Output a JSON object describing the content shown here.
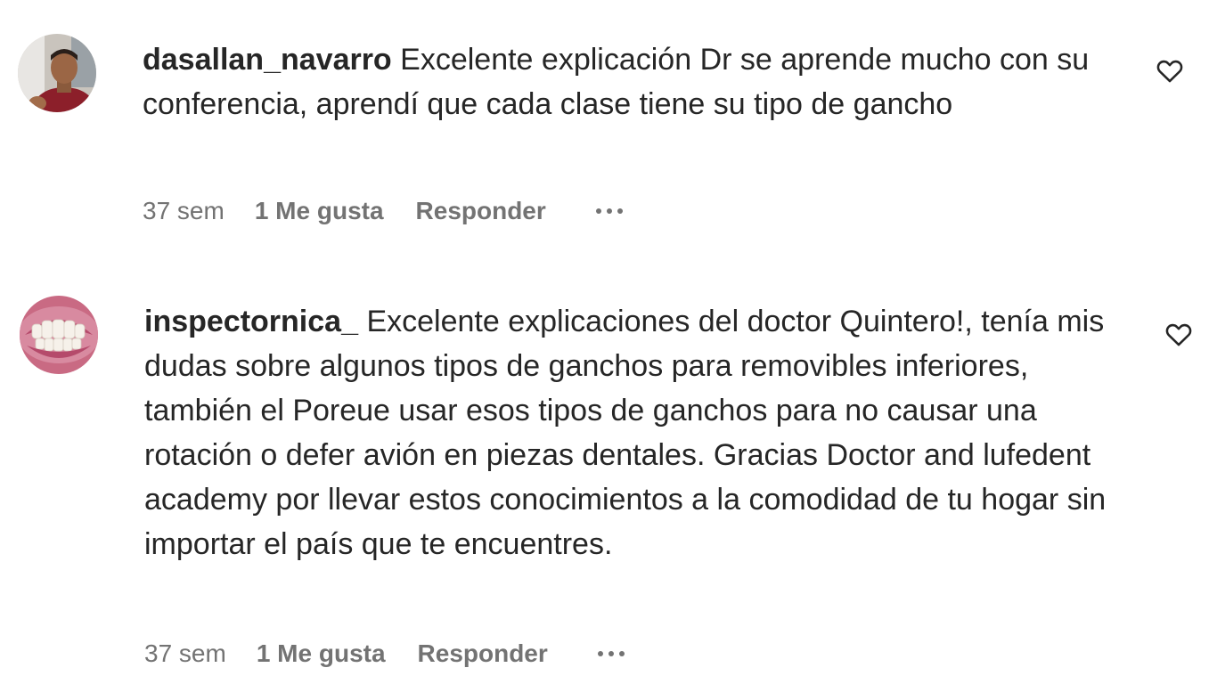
{
  "comments": [
    {
      "username": "dasallan_navarro",
      "text": "Excelente explicación Dr se aprende mucho con su conferencia, aprendí que cada clase tiene su tipo de gancho",
      "time": "37 sem",
      "likes": "1 Me gusta",
      "reply": "Responder",
      "avatar": "man-portrait-avatar",
      "like_icon": "heart-outline-icon",
      "more_icon": "more-horizontal-icon"
    },
    {
      "username": "inspectornica_",
      "text": "Excelente explicaciones del doctor Quintero!, tenía mis dudas sobre algunos tipos de ganchos para removibles inferiores, también el Poreue usar esos tipos de ganchos para no causar una rotación o defer avión en piezas dentales. Gracias Doctor and lufedent academy por llevar estos conocimientos a la comodidad de tu hogar sin importar el país que te encuentres.",
      "time": "37 sem",
      "likes": "1 Me gusta",
      "reply": "Responder",
      "avatar": "teeth-photo-avatar",
      "like_icon": "heart-outline-icon",
      "more_icon": "more-horizontal-icon"
    }
  ],
  "colors": {
    "text": "#262626",
    "secondary": "#737373",
    "background": "#ffffff"
  }
}
